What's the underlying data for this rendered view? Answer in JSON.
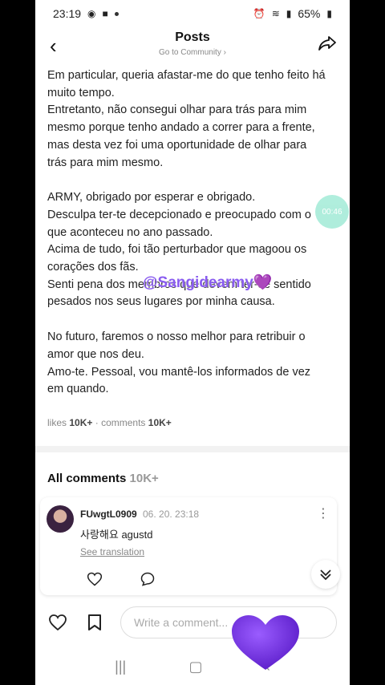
{
  "status_bar": {
    "time": "23:19",
    "battery": "65%"
  },
  "header": {
    "title": "Posts",
    "subtitle": "Go to Community ›"
  },
  "post": {
    "paragraphs": [
      "Em particular, queria afastar-me do que tenho feito há muito tempo.",
      "Entretanto, não consegui olhar para trás para mim mesmo porque tenho andado a correr para a frente, mas desta vez foi uma oportunidade de olhar para trás para mim mesmo.",
      "ARMY, obrigado por esperar e obrigado.",
      "Desculpa ter-te decepcionado e preocupado com o que aconteceu no ano passado.",
      "Acima de tudo, foi tão perturbador que magoou os corações dos fãs.",
      "Senti pena dos membros que devem ter-se sentido pesados nos seus lugares por minha causa.",
      "No futuro, faremos o nosso melhor para retribuir o amor que nos deu.",
      "Amo-te. Pessoal, vou mantê-los informados de vez em quando."
    ],
    "watermark": "@Sangidearmy💜",
    "timer": "00:46",
    "likes_label": "likes",
    "likes_count": "10K+",
    "comments_label": "comments",
    "comments_count": "10K+"
  },
  "comments_section": {
    "title": "All comments",
    "count": "10K+",
    "comment": {
      "user": "FUwgtL0909",
      "date": "06. 20. 23:18",
      "text": "사랑해요 agustd",
      "translate": "See translation"
    }
  },
  "bottom_bar": {
    "input_placeholder": "Write a comment..."
  },
  "colors": {
    "heart": "#7a35e0",
    "timer": "#a7ecd9"
  }
}
